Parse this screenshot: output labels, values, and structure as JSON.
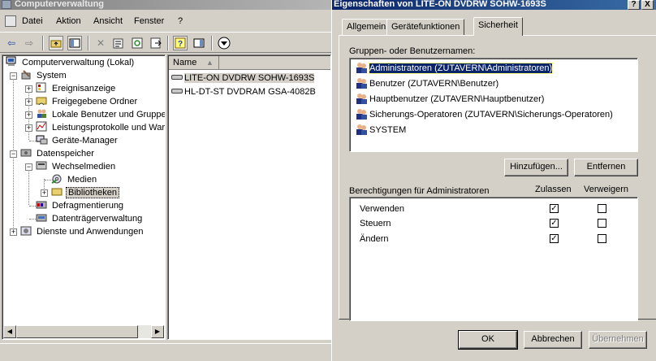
{
  "main_window": {
    "title": "Computerverwaltung",
    "menu": [
      "Datei",
      "Aktion",
      "Ansicht",
      "Fenster",
      "?"
    ]
  },
  "tree": {
    "root": "Computerverwaltung (Lokal)",
    "system": "System",
    "ereignis": "Ereignisanzeige",
    "ordner": "Freigegebene Ordner",
    "benutzer": "Lokale Benutzer und Gruppen",
    "leistung": "Leistungsprotokolle und Warnungen",
    "geraete": "Geräte-Manager",
    "datenspeicher": "Datenspeicher",
    "wechselmedien": "Wechselmedien",
    "medien": "Medien",
    "bibliotheken": "Bibliotheken",
    "defrag": "Defragmentierung",
    "dtv": "Datenträgerverwaltung",
    "dienste": "Dienste und Anwendungen"
  },
  "list": {
    "column_name": "Name",
    "items": [
      "LITE-ON DVDRW SOHW-1693S",
      "HL-DT-ST DVDRAM GSA-4082B"
    ]
  },
  "dialog": {
    "title": "Eigenschaften von LITE-ON DVDRW SOHW-1693S",
    "help_btn": "?",
    "close_btn": "X",
    "tabs": [
      "Allgemein",
      "Gerätefunktionen",
      "Sicherheit"
    ],
    "groups_label": "Gruppen- oder Benutzernamen:",
    "users": [
      "Administratoren (ZUTAVERN\\Administratoren)",
      "Benutzer (ZUTAVERN\\Benutzer)",
      "Hauptbenutzer (ZUTAVERN\\Hauptbenutzer)",
      "Sicherungs-Operatoren (ZUTAVERN\\Sicherungs-Operatoren)",
      "SYSTEM"
    ],
    "add_btn": "Hinzufügen...",
    "remove_btn": "Entfernen",
    "perm_label": "Berechtigungen für Administratoren",
    "allow_label": "Zulassen",
    "deny_label": "Verweigern",
    "permissions": [
      {
        "name": "Verwenden",
        "allow": true,
        "deny": false
      },
      {
        "name": "Steuern",
        "allow": true,
        "deny": false
      },
      {
        "name": "Ändern",
        "allow": true,
        "deny": false
      }
    ],
    "ok_btn": "OK",
    "cancel_btn": "Abbrechen",
    "apply_btn": "Übernehmen"
  }
}
